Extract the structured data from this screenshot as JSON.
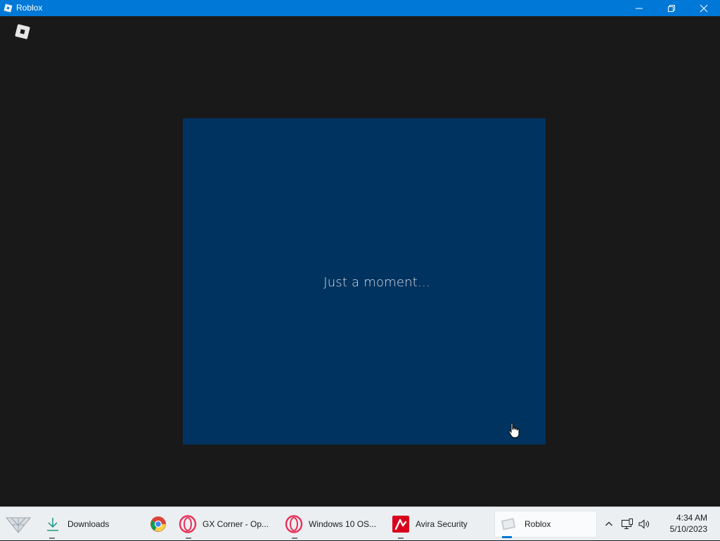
{
  "window": {
    "title": "Roblox",
    "icons": {
      "app": "roblox-icon",
      "minimize": "minimize-icon",
      "restore": "restore-icon",
      "close": "close-icon"
    }
  },
  "client": {
    "logo": "roblox-logo-icon",
    "loading_text": "Just a moment...",
    "colors": {
      "background": "#191919",
      "dialog": "#00335f",
      "titlebar": "#0078d7"
    }
  },
  "taskbar": {
    "start_icon": "start-menu-icon",
    "items": [
      {
        "label": "Downloads",
        "icon": "download-icon"
      },
      {
        "label": "",
        "icon": "chrome-icon"
      },
      {
        "label": "GX Corner - Op...",
        "icon": "opera-gx-icon"
      },
      {
        "label": "Windows 10 OS...",
        "icon": "opera-gx-icon"
      },
      {
        "label": "Avira Security",
        "icon": "avira-icon"
      },
      {
        "label": "Roblox",
        "icon": "roblox-icon"
      }
    ],
    "tray": {
      "chevron": "chevron-up-icon",
      "network": "network-icon",
      "volume": "volume-icon"
    },
    "clock": {
      "time": "4:34 AM",
      "date": "5/10/2023"
    }
  }
}
